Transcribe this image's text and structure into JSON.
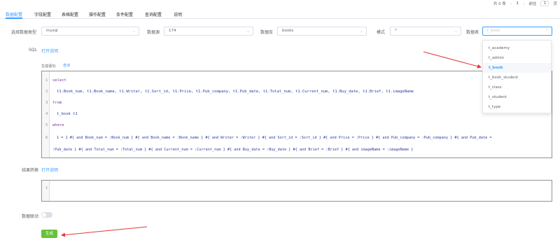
{
  "pager": {
    "total": "共 0 条",
    "prev": "‹",
    "current": "1",
    "next": "›",
    "goto": "前往",
    "page_value": "1",
    "page_unit": "页"
  },
  "tabs": [
    {
      "label": "数据配置",
      "active": true
    },
    {
      "label": "字段配置",
      "active": false
    },
    {
      "label": "表格配置",
      "active": false
    },
    {
      "label": "操作配置",
      "active": false
    },
    {
      "label": "条件配置",
      "active": false
    },
    {
      "label": "查询配置",
      "active": false
    },
    {
      "label": "说明",
      "active": false
    }
  ],
  "filters": {
    "db_type_label": "选择数据类型",
    "db_type_value": "mysql",
    "datasource_label": "数据源",
    "datasource_value": "174",
    "database_label": "数据库",
    "database_value": "books",
    "schema_label": "模式",
    "schema_value": "*",
    "table_label": "数据表",
    "table_placeholder": "t_book"
  },
  "table_dropdown": {
    "items": [
      "t_academy",
      "t_admin",
      "t_book",
      "t_book_student",
      "t_class",
      "t_student",
      "t_type"
    ],
    "highlighted": "t_book"
  },
  "sql_section": {
    "label": "SQL",
    "help_link": "打开说明",
    "gen_label": "生成语句:",
    "gen_link": "查询"
  },
  "sql_lines": [
    {
      "num": "1",
      "text": "select"
    },
    {
      "num": "2",
      "text": "t1.Book_num,  t1.Book_name, t1.Writer,  t1.Sort_id, t1.Price, t1.Pub_company, t1.Pub_date,  t1.Total_num, t1.Current_num, t1.Buy_date,  t1.Brief, t1.imageName"
    },
    {
      "num": "3",
      "text": "from"
    },
    {
      "num": "4",
      "text": "t_book t1"
    },
    {
      "num": "5",
      "text": "where"
    },
    {
      "num": "6",
      "text": "1 = 1 #{ and Book_num = :Book_num } #{ and Book_name = :Book_name } #{ and Writer = :Writer } #{ and Sort_id = :Sort_id } #{ and Price = :Price } #{ and Pub_company = :Pub_company } #{ and Pub_date ="
    },
    {
      "num": "",
      "text": ":Pub_date } #{ and Total_num = :Total_num } #{ and Current_num = :Current_num } #{ and Buy_date = :Buy_date } #{ and Brief = :Brief } #{ and imageName = :imageName }"
    }
  ],
  "result_section": {
    "label": "结果转换",
    "help_link": "打开说明",
    "line_num": "1"
  },
  "linkage": {
    "label": "数据联动",
    "enabled": false
  },
  "generate_button": "生成",
  "colors": {
    "accent": "#409eff",
    "success": "#67c23a",
    "annotation": "#e53935"
  }
}
